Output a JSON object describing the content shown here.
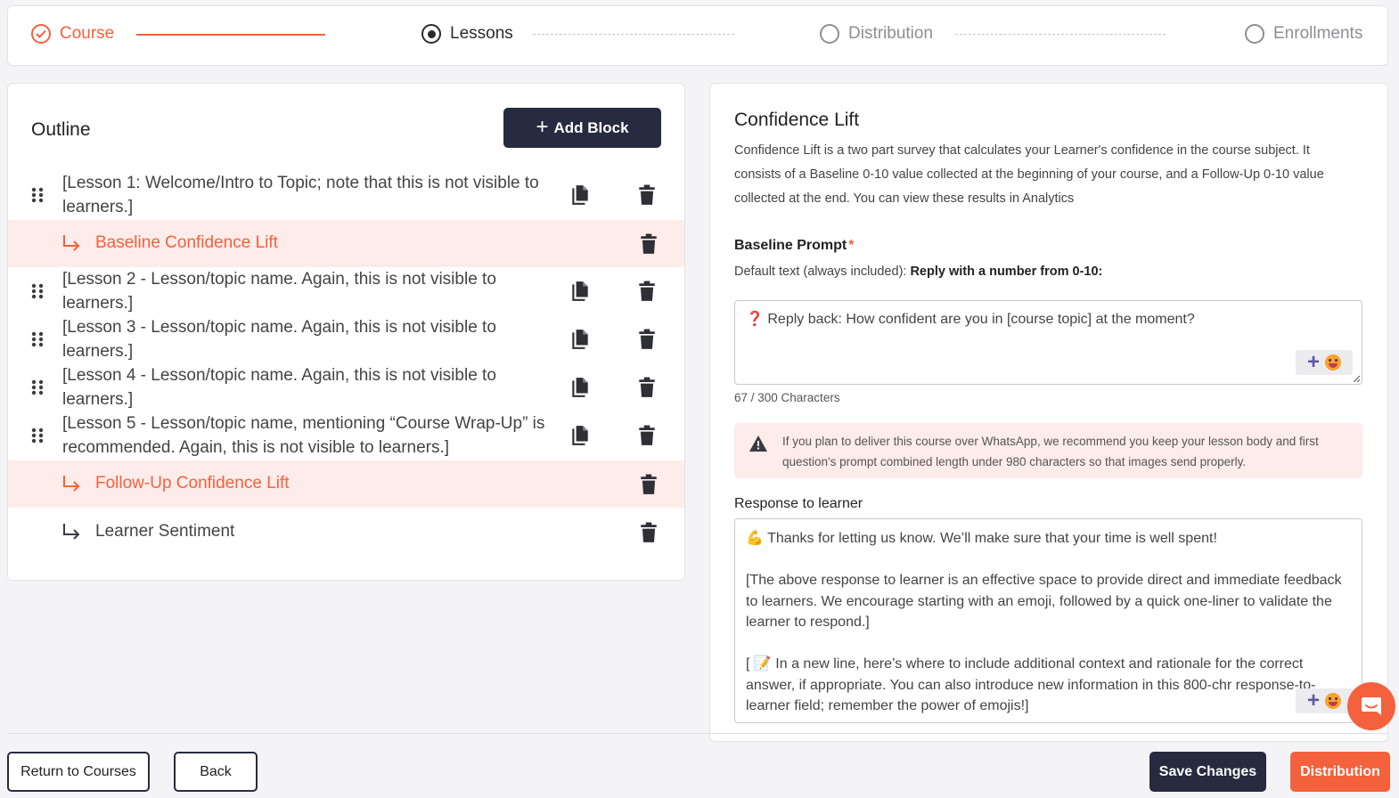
{
  "stepper": {
    "steps": [
      {
        "label": "Course",
        "state": "done"
      },
      {
        "label": "Lessons",
        "state": "active"
      },
      {
        "label": "Distribution",
        "state": "todo"
      },
      {
        "label": "Enrollments",
        "state": "todo"
      }
    ]
  },
  "outline": {
    "title": "Outline",
    "add_block_label": "Add Block",
    "lessons": [
      "[Lesson 1: Welcome/Intro to Topic; note that this is not visible to learners.]",
      "[Lesson 2 - Lesson/topic name. Again, this is not visible to learners.]",
      "[Lesson 3 - Lesson/topic name. Again, this is not visible to learners.]",
      "[Lesson 4 - Lesson/topic name. Again, this is not visible to learners.]",
      "[Lesson 5 - Lesson/topic name, mentioning “Course Wrap-Up” is recommended. Again, this is not visible to learners.]"
    ],
    "blocks": [
      {
        "label": "Baseline Confidence Lift",
        "selected": true
      },
      {
        "label": "Follow-Up Confidence Lift",
        "selected": true
      },
      {
        "label": "Learner Sentiment",
        "selected": false
      }
    ]
  },
  "detail": {
    "title": "Confidence Lift",
    "description": "Confidence Lift is a two part survey that calculates your Learner's confidence in the course subject. It consists of a Baseline 0-10 value collected at the beginning of your course, and a Follow-Up 0-10 value collected at the end. You can view these results in Analytics",
    "baseline_label": "Baseline Prompt",
    "required_mark": "*",
    "default_prefix": "Default text (always included):",
    "default_value": "Reply with a number from 0-10:",
    "baseline_emoji": "❓",
    "baseline_value": "Reply back: How confident are you in [course topic] at the moment?",
    "baseline_count": "67 / 300 Characters",
    "warning": "If you plan to deliver this course over WhatsApp, we recommend you keep your lesson body and first question's prompt combined length under 980 characters so that images send properly.",
    "response_label": "Response to learner",
    "response_p1_emoji": "💪",
    "response_p1": "Thanks for letting us know. We’ll make sure that your time is well spent!",
    "response_p2": "[The above response to learner is an effective space to provide direct and immediate feedback to learners. We encourage starting with an emoji, followed by a quick one-liner to validate the learner to respond.]",
    "response_p3_prefix": "[",
    "response_p3_emoji": "📝",
    "response_p3": "In a new line, here’s where to include additional context and rationale for the correct answer, if appropriate. You can also introduce new information in this 800-chr response-to-learner field; remember the power of emojis!]"
  },
  "footer": {
    "return_label": "Return to Courses",
    "back_label": "Back",
    "save_label": "Save Changes",
    "next_label": "Distribution"
  },
  "colors": {
    "accent": "#f4613d",
    "dark": "#262b40",
    "highlight": "#fdecea"
  },
  "icons": [
    "check-circle-icon",
    "radio-dot-icon",
    "radio-empty-icon",
    "plus-icon",
    "drag-handle-icon",
    "copy-icon",
    "trash-icon",
    "sub-arrow-icon",
    "warning-icon",
    "chat-icon"
  ]
}
